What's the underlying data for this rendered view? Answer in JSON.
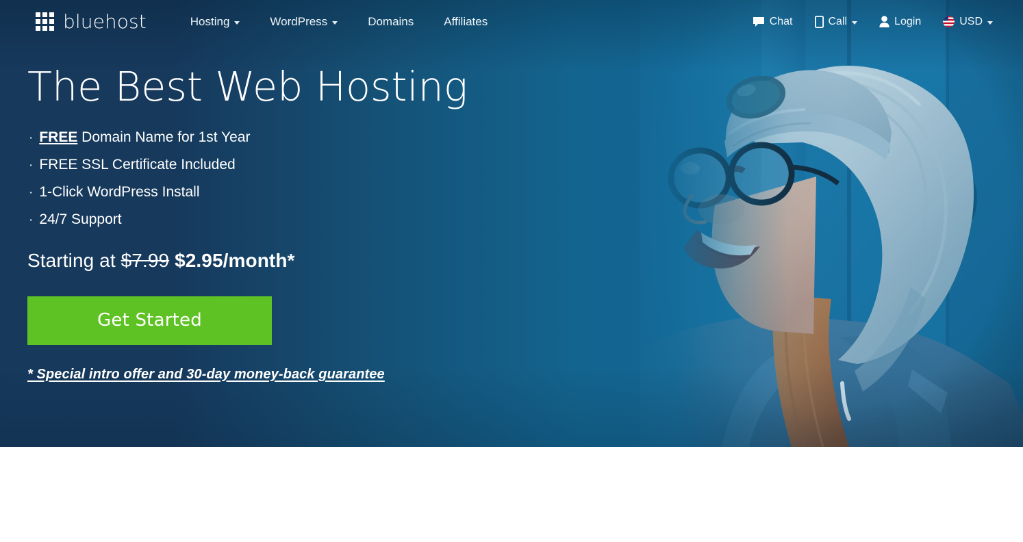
{
  "brand": {
    "name": "bluehost",
    "logo_icon": "grid-3x3-icon"
  },
  "nav": {
    "items": [
      {
        "label": "Hosting",
        "has_dropdown": true
      },
      {
        "label": "WordPress",
        "has_dropdown": true
      },
      {
        "label": "Domains",
        "has_dropdown": false
      },
      {
        "label": "Affiliates",
        "has_dropdown": false
      }
    ]
  },
  "utilities": [
    {
      "label": "Chat",
      "icon": "chat-bubble-icon",
      "has_dropdown": false
    },
    {
      "label": "Call",
      "icon": "mobile-phone-icon",
      "has_dropdown": true
    },
    {
      "label": "Login",
      "icon": "user-person-icon",
      "has_dropdown": false
    },
    {
      "label": "USD",
      "icon": "us-flag-icon",
      "has_dropdown": true
    }
  ],
  "hero": {
    "title": "The Best Web Hosting",
    "features": [
      {
        "bullet": "·",
        "strong": "FREE",
        "rest": " Domain Name for 1st Year"
      },
      {
        "bullet": "·",
        "strong": "",
        "rest": "FREE SSL Certificate Included"
      },
      {
        "bullet": "·",
        "strong": "",
        "rest": "1-Click WordPress Install"
      },
      {
        "bullet": "·",
        "strong": "",
        "rest": "24/7 Support"
      }
    ],
    "price": {
      "prefix": "Starting at ",
      "old": "$7.99",
      "new": " $2.95/month*"
    },
    "cta_label": "Get Started",
    "footnote": "* Special intro offer and 30-day money-back guarantee",
    "photo_alt": "smiling-woman-glasses-beanie-denim-jacket"
  },
  "colors": {
    "brand_dark_blue": "#16395c",
    "brand_mid_blue": "#13648f",
    "cta_green": "#5fc224",
    "text_white": "#ffffff",
    "page_background": "#ffffff"
  }
}
